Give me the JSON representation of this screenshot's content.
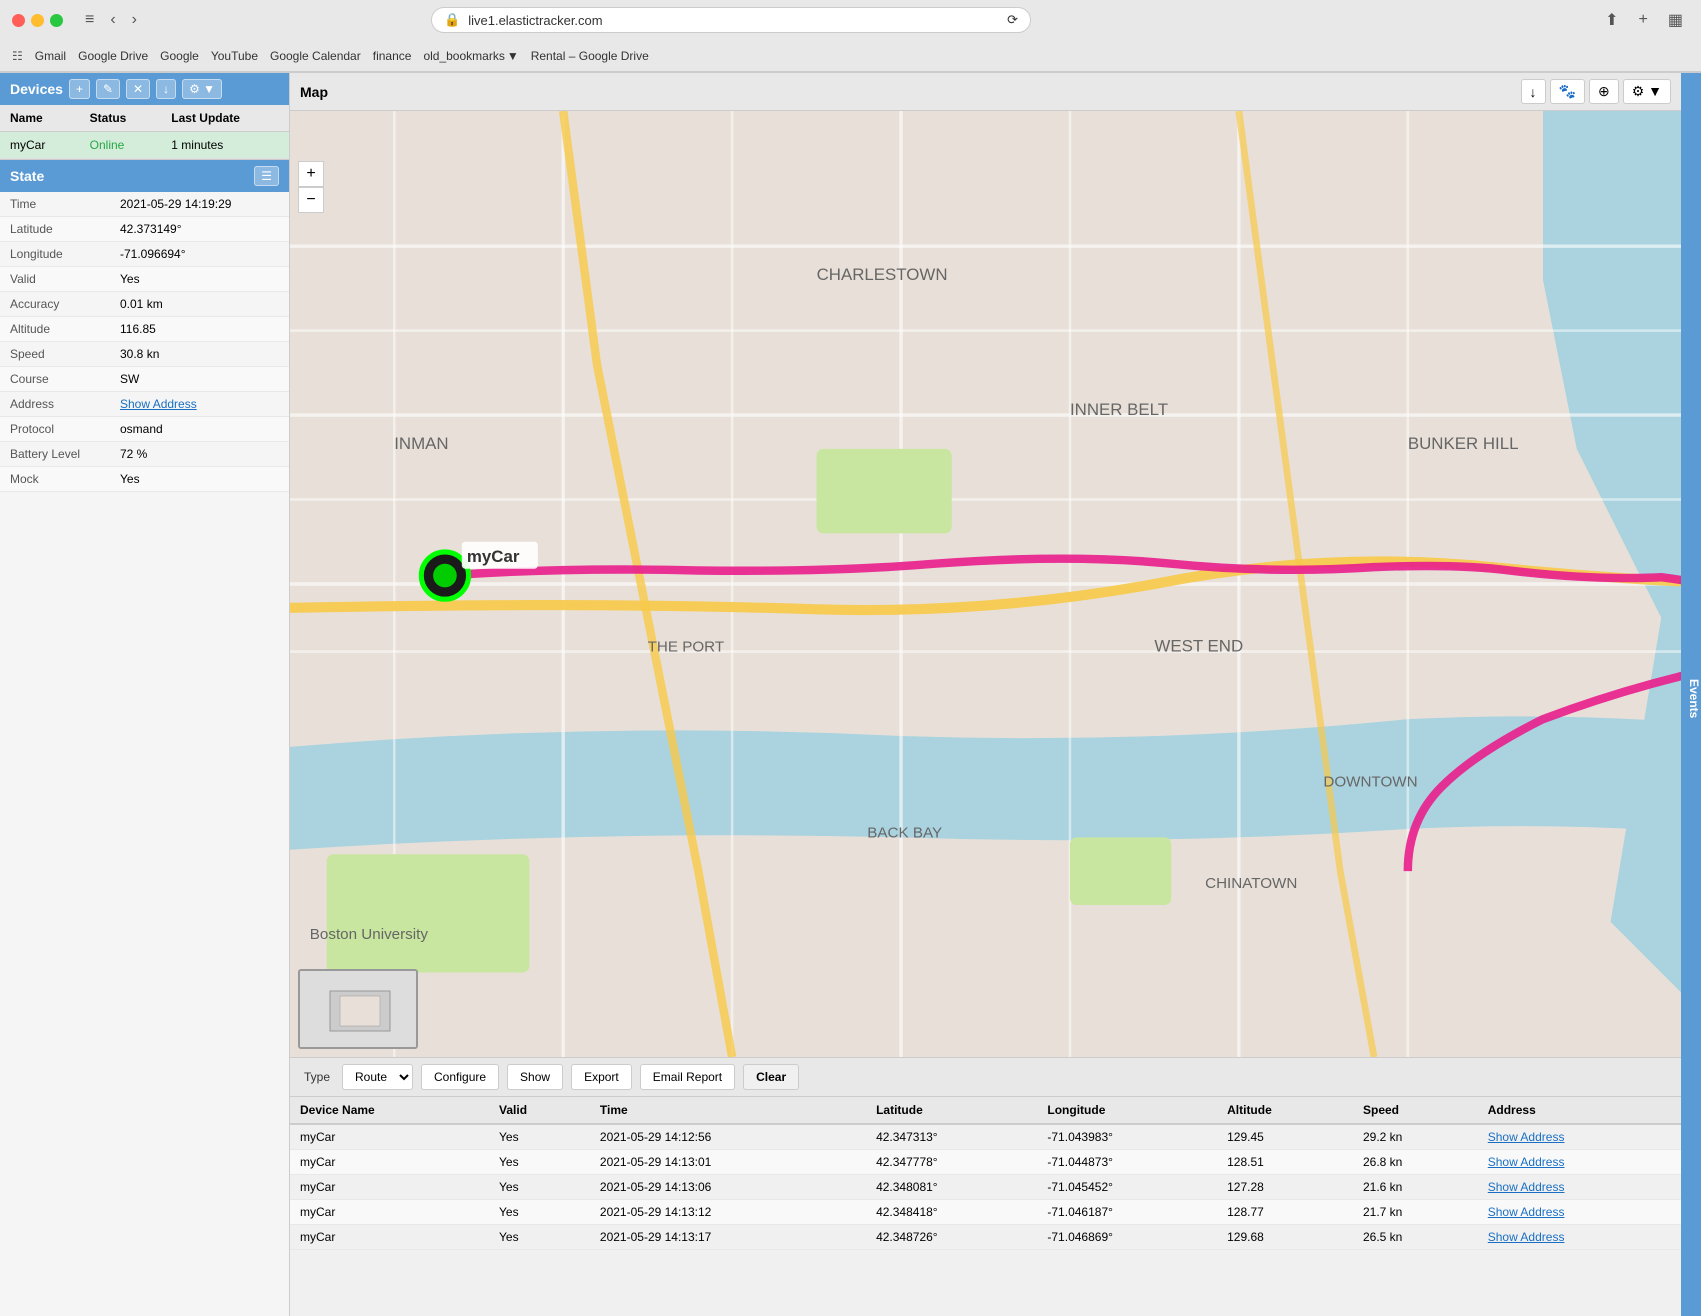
{
  "browser": {
    "url": "live1.elastictracker.com",
    "bookmarks": [
      "Gmail",
      "Google Drive",
      "Google",
      "YouTube",
      "Google Calendar",
      "finance",
      "old_bookmarks",
      "Rental – Google Drive"
    ]
  },
  "devices_panel": {
    "title": "Devices",
    "columns": [
      "Name",
      "Status",
      "Last Update"
    ],
    "rows": [
      {
        "name": "myCar",
        "status": "Online",
        "last_update": "1 minutes"
      }
    ]
  },
  "state_panel": {
    "title": "State",
    "attributes": [
      {
        "key": "Time",
        "value": "2021-05-29 14:19:29"
      },
      {
        "key": "Latitude",
        "value": "42.373149°"
      },
      {
        "key": "Longitude",
        "value": "-71.096694°"
      },
      {
        "key": "Valid",
        "value": "Yes"
      },
      {
        "key": "Accuracy",
        "value": "0.01 km"
      },
      {
        "key": "Altitude",
        "value": "116.85"
      },
      {
        "key": "Speed",
        "value": "30.8 kn"
      },
      {
        "key": "Course",
        "value": "SW"
      },
      {
        "key": "Address",
        "value": "Show Address",
        "is_link": true
      },
      {
        "key": "Protocol",
        "value": "osmand"
      },
      {
        "key": "Battery Level",
        "value": "72 %"
      },
      {
        "key": "Mock",
        "value": "Yes"
      }
    ]
  },
  "map": {
    "title": "Map"
  },
  "toolbar": {
    "type_label": "Type",
    "route_value": "Route",
    "configure_label": "Configure",
    "show_label": "Show",
    "export_label": "Export",
    "email_report_label": "Email Report",
    "clear_label": "Clear"
  },
  "data_table": {
    "columns": [
      "Device Name",
      "Valid",
      "Time",
      "Latitude",
      "Longitude",
      "Altitude",
      "Speed",
      "Address"
    ],
    "rows": [
      {
        "device": "myCar",
        "valid": "Yes",
        "time": "2021-05-29 14:12:56",
        "lat": "42.347313°",
        "lon": "-71.043983°",
        "alt": "129.45",
        "speed": "29.2 kn",
        "address": "Show Address"
      },
      {
        "device": "myCar",
        "valid": "Yes",
        "time": "2021-05-29 14:13:01",
        "lat": "42.347778°",
        "lon": "-71.044873°",
        "alt": "128.51",
        "speed": "26.8 kn",
        "address": "Show Address"
      },
      {
        "device": "myCar",
        "valid": "Yes",
        "time": "2021-05-29 14:13:06",
        "lat": "42.348081°",
        "lon": "-71.045452°",
        "alt": "127.28",
        "speed": "21.6 kn",
        "address": "Show Address"
      },
      {
        "device": "myCar",
        "valid": "Yes",
        "time": "2021-05-29 14:13:12",
        "lat": "42.348418°",
        "lon": "-71.046187°",
        "alt": "128.77",
        "speed": "21.7 kn",
        "address": "Show Address"
      },
      {
        "device": "myCar",
        "valid": "Yes",
        "time": "2021-05-29 14:13:17",
        "lat": "42.348726°",
        "lon": "-71.046869°",
        "alt": "129.68",
        "speed": "26.5 kn",
        "address": "Show Address"
      }
    ]
  },
  "events_sidebar": {
    "label": "Events"
  }
}
